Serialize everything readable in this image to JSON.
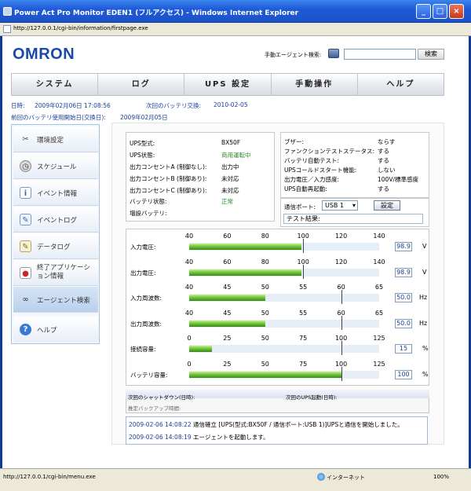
{
  "window": {
    "title": "Power Act Pro Monitor EDEN1 (フルアクセス) - Windows Internet Explorer",
    "address": "http://127.0.0.1/cgi-bin/information/firstpage.exe",
    "status_url": "http://127.0.0.1/cgi-bin/menu.exe",
    "status_zone": "インターネット",
    "zoom": "100%"
  },
  "header": {
    "logo": "OMRON",
    "search_label": "手動エージェント検索:",
    "search_value": "",
    "search_button": "検索"
  },
  "menu": [
    "システム",
    "ログ",
    "UPS 設定",
    "手動操作",
    "ヘルプ"
  ],
  "info": {
    "datetime_label": "日時:",
    "datetime": "2009年02月06日 17:08:56",
    "next_battery_label": "次回のバッテリ交換:",
    "next_battery": "2010-02-05",
    "last_battery_label": "前回のバッテリ使用開始日(交換日):",
    "last_battery": "2009年02月05日"
  },
  "sidebar": [
    {
      "label": "環境設定",
      "icon": "tools-icon"
    },
    {
      "label": "スケジュール",
      "icon": "clock-icon"
    },
    {
      "label": "イベント情報",
      "icon": "event-info-icon"
    },
    {
      "label": "イベントログ",
      "icon": "event-log-icon"
    },
    {
      "label": "データログ",
      "icon": "data-log-icon"
    },
    {
      "label": "終了アプリケーション情報",
      "icon": "shutdown-app-icon"
    },
    {
      "label": "エージェント検索",
      "icon": "binoculars-icon"
    },
    {
      "label": "ヘルプ",
      "icon": "help-icon"
    }
  ],
  "ups": {
    "rows": [
      {
        "label": "UPS型式:",
        "value": "BX50F"
      },
      {
        "label": "UPS状態:",
        "value": "商用運転中"
      },
      {
        "label": "出力コンセントA (制御なし):",
        "value": "出力中"
      },
      {
        "label": "出力コンセントB (制御あり):",
        "value": "未対応"
      },
      {
        "label": "出力コンセントC (制御あり):",
        "value": "未対応"
      },
      {
        "label": "バッテリ状態:",
        "value": "正常"
      },
      {
        "label": "増設バッテリ:",
        "value": ""
      }
    ]
  },
  "settings": {
    "rows": [
      {
        "label": "ブザー:",
        "value": "ならす"
      },
      {
        "label": "ファンクションテストステータス:",
        "value": "する"
      },
      {
        "label": "バッテリ自動テスト:",
        "value": "する"
      },
      {
        "label": "UPSコールドスタート機能:",
        "value": "しない"
      },
      {
        "label": "出力電圧／入力感度:",
        "value": "100V/標準感度"
      },
      {
        "label": "UPS自動再起動:",
        "value": "する"
      }
    ],
    "port_label": "通信ポート:",
    "port_value": "USB 1",
    "set_button": "設定",
    "test_result_label": "テスト結果:"
  },
  "gauges": [
    {
      "label": "入力電圧:",
      "ticks": [
        "40",
        "60",
        "80",
        "100",
        "120",
        "140"
      ],
      "min": 40,
      "max": 140,
      "value": 98.9,
      "display": "98.9",
      "unit": "V",
      "marker": 100
    },
    {
      "label": "出力電圧:",
      "ticks": [
        "40",
        "60",
        "80",
        "100",
        "120",
        "140"
      ],
      "min": 40,
      "max": 140,
      "value": 98.9,
      "display": "98.9",
      "unit": "V",
      "marker": 100
    },
    {
      "label": "入力周波数:",
      "ticks": [
        "40",
        "45",
        "50",
        "55",
        "60",
        "65"
      ],
      "min": 40,
      "max": 65,
      "value": 50.0,
      "display": "50.0",
      "unit": "Hz",
      "marker": 60
    },
    {
      "label": "出力周波数:",
      "ticks": [
        "40",
        "45",
        "50",
        "55",
        "60",
        "65"
      ],
      "min": 40,
      "max": 65,
      "value": 50.0,
      "display": "50.0",
      "unit": "Hz",
      "marker": 60
    },
    {
      "label": "接続容量:",
      "ticks": [
        "0",
        "25",
        "50",
        "75",
        "100",
        "125"
      ],
      "min": 0,
      "max": 125,
      "value": 15,
      "display": "15",
      "unit": "%",
      "marker": 100
    },
    {
      "label": "バッテリ容量:",
      "ticks": [
        "0",
        "25",
        "50",
        "75",
        "100",
        "125"
      ],
      "min": 0,
      "max": 125,
      "value": 100,
      "display": "100",
      "unit": "%",
      "marker": 100
    }
  ],
  "schedule": {
    "next_shutdown_label": "次回のシャットダウン(日時):",
    "next_start_label": "次回のUPS起動(日時):",
    "backup_label": "推定バックアップ時間:"
  },
  "log": [
    {
      "time": "2009-02-06 14:08:22",
      "text": "通信確立 [UPS(型式:BX50F / 通信ポート:USB 1)]UPSと通信を開始しました。"
    },
    {
      "time": "2009-02-06 14:08:19",
      "text": "エージェントを起動します。"
    }
  ]
}
